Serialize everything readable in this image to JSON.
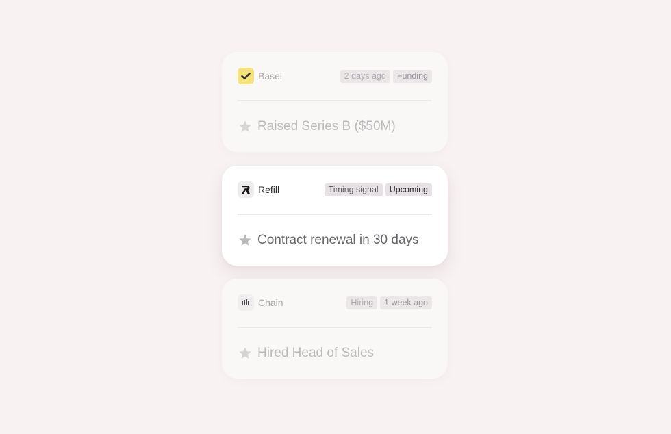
{
  "cards": [
    {
      "company": "Basel",
      "logo_icon": "check-icon",
      "logo_bg": "#f6e27a",
      "badges": [
        "2 days ago",
        "Funding"
      ],
      "signal": "Raised Series B ($50M)",
      "state": "faded"
    },
    {
      "company": "Refill",
      "logo_icon": "refill-logo-icon",
      "logo_bg": "#efecee",
      "badges": [
        "Timing signal",
        "Upcoming"
      ],
      "signal": "Contract renewal in 30 days",
      "state": "active"
    },
    {
      "company": "Chain",
      "logo_icon": "chain-logo-icon",
      "logo_bg": "#f1eeef",
      "badges": [
        "Hiring",
        "1 week ago"
      ],
      "signal": "Hired Head of Sales",
      "state": "faded"
    }
  ],
  "colors": {
    "background": "#f8f2f2",
    "card_active": "#ffffff",
    "card_faded": "#faf7f7",
    "basel_accent": "#f6e27a"
  }
}
